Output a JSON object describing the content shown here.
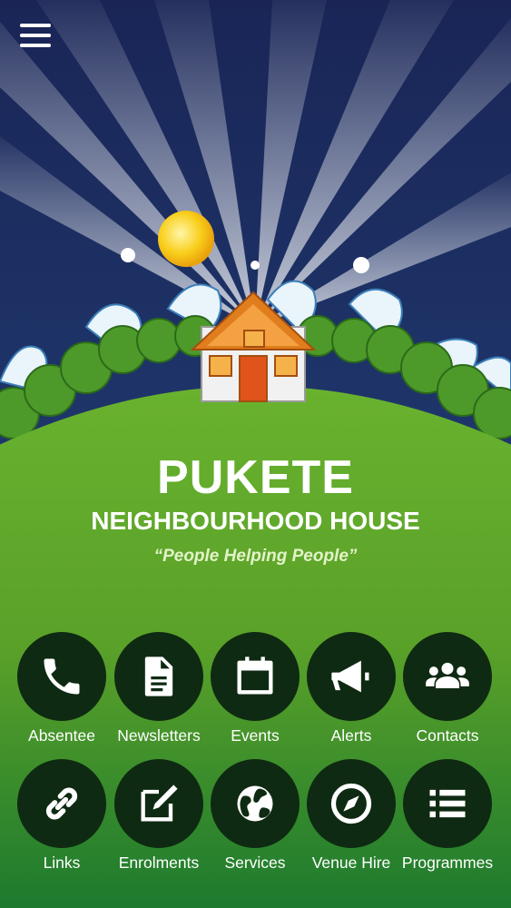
{
  "header": {
    "menu_icon": "hamburger-menu-icon"
  },
  "branding": {
    "title": "PUKETE",
    "subtitle": "NEIGHBOURHOOD HOUSE",
    "tagline": "“People Helping People”"
  },
  "tiles": [
    {
      "label": "Absentee",
      "icon": "phone-icon"
    },
    {
      "label": "Newsletters",
      "icon": "document-icon"
    },
    {
      "label": "Events",
      "icon": "calendar-icon"
    },
    {
      "label": "Alerts",
      "icon": "megaphone-icon"
    },
    {
      "label": "Contacts",
      "icon": "group-icon"
    },
    {
      "label": "Links",
      "icon": "link-icon"
    },
    {
      "label": "Enrolments",
      "icon": "edit-icon"
    },
    {
      "label": "Services",
      "icon": "globe-icon"
    },
    {
      "label": "Venue Hire",
      "icon": "compass-icon"
    },
    {
      "label": "Programmes",
      "icon": "list-icon"
    }
  ],
  "colors": {
    "sky": "#1c2a5a",
    "grass": "#5ea52b",
    "tile_bg": "#0f2a12",
    "house_roof": "#e07d1c",
    "door": "#e0531a"
  }
}
